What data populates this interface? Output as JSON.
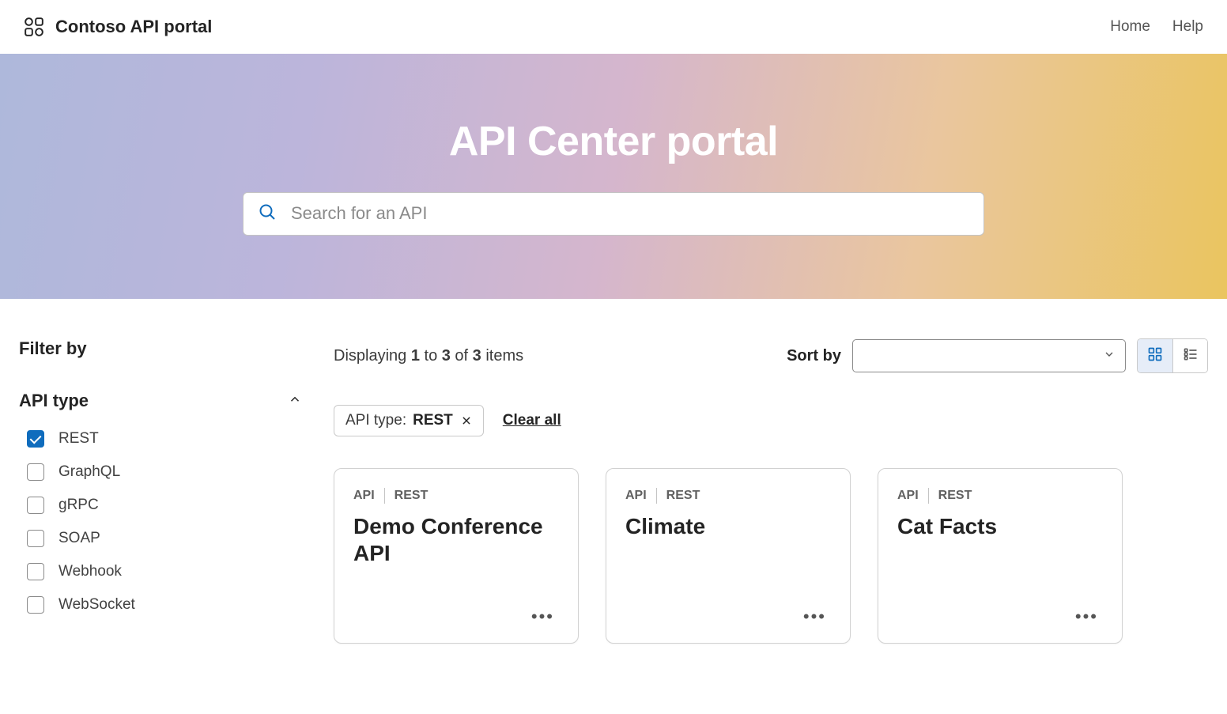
{
  "header": {
    "site_title": "Contoso API portal",
    "nav": {
      "home": "Home",
      "help": "Help"
    }
  },
  "hero": {
    "title": "API Center portal",
    "search_placeholder": "Search for an API"
  },
  "sidebar": {
    "filter_heading": "Filter by",
    "group_title": "API type",
    "options": [
      {
        "label": "REST",
        "checked": true
      },
      {
        "label": "GraphQL",
        "checked": false
      },
      {
        "label": "gRPC",
        "checked": false
      },
      {
        "label": "SOAP",
        "checked": false
      },
      {
        "label": "Webhook",
        "checked": false
      },
      {
        "label": "WebSocket",
        "checked": false
      }
    ]
  },
  "toolbar": {
    "display_prefix": "Displaying ",
    "from": "1",
    "to_word": " to ",
    "to": "3",
    "of_word": " of ",
    "total": "3",
    "items_word": " items",
    "sortby_label": "Sort by"
  },
  "chips": {
    "label": "API type: ",
    "value": "REST",
    "clear_all": "Clear all"
  },
  "cards": [
    {
      "tag1": "API",
      "tag2": "REST",
      "title": "Demo Conference API"
    },
    {
      "tag1": "API",
      "tag2": "REST",
      "title": "Climate"
    },
    {
      "tag1": "API",
      "tag2": "REST",
      "title": "Cat Facts"
    }
  ]
}
